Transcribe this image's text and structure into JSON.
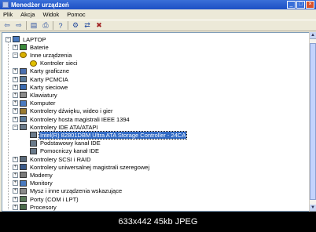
{
  "window": {
    "title": "Menedżer urządzeń"
  },
  "title_controls": {
    "minimize": "_",
    "maximize": "□",
    "close": "×"
  },
  "menu": [
    {
      "label": "Plik"
    },
    {
      "label": "Akcja"
    },
    {
      "label": "Widok"
    },
    {
      "label": "Pomoc"
    }
  ],
  "toolbar": [
    {
      "icon": "back-icon",
      "glyph": "⇦"
    },
    {
      "icon": "forward-icon",
      "glyph": "⇨"
    },
    {
      "icon": "properties-icon",
      "glyph": "▤"
    },
    {
      "icon": "print-icon",
      "glyph": "⎙"
    },
    {
      "icon": "help-icon",
      "glyph": "?"
    },
    {
      "icon": "scan-hardware-icon",
      "glyph": "⚙"
    },
    {
      "icon": "update-driver-icon",
      "glyph": "⇄"
    },
    {
      "icon": "uninstall-icon",
      "glyph": "✖"
    }
  ],
  "tree": {
    "root": {
      "label": "LAPTOP",
      "expander": "−"
    },
    "items": [
      {
        "label": "Baterie",
        "expander": "+",
        "level": 1,
        "icon": "battery-icon",
        "color": "#3a8a3a"
      },
      {
        "label": "Inne urządzenia",
        "expander": "−",
        "level": 1,
        "icon": "unknown-device-icon",
        "color": "#d8b000"
      },
      {
        "label": "Kontroler sieci",
        "expander": "",
        "level": 2,
        "icon": "warning-device-icon",
        "color": "#e0c000"
      },
      {
        "label": "Karty graficzne",
        "expander": "+",
        "level": 1,
        "icon": "display-adapter-icon",
        "color": "#4a6fb0"
      },
      {
        "label": "Karty PCMCIA",
        "expander": "+",
        "level": 1,
        "icon": "pcmcia-icon",
        "color": "#5a7a9a"
      },
      {
        "label": "Karty sieciowe",
        "expander": "+",
        "level": 1,
        "icon": "network-adapter-icon",
        "color": "#3a6ab0"
      },
      {
        "label": "Klawiatury",
        "expander": "+",
        "level": 1,
        "icon": "keyboard-icon",
        "color": "#8a8a8a"
      },
      {
        "label": "Komputer",
        "expander": "+",
        "level": 1,
        "icon": "computer-icon",
        "color": "#4a7ac0"
      },
      {
        "label": "Kontrolery dźwięku, wideo i gier",
        "expander": "+",
        "level": 1,
        "icon": "sound-icon",
        "color": "#9a7a30"
      },
      {
        "label": "Kontrolery hosta magistrali IEEE 1394",
        "expander": "+",
        "level": 1,
        "icon": "ieee1394-icon",
        "color": "#5a7a9a"
      },
      {
        "label": "Kontrolery IDE ATA/ATAPI",
        "expander": "−",
        "level": 1,
        "icon": "ide-controller-icon",
        "color": "#6a7a8a"
      },
      {
        "label": "Intel(R) 82801DBM Ultra ATA Storage Controller - 24CA",
        "expander": "",
        "level": 2,
        "icon": "ide-device-icon",
        "color": "#6a7a8a",
        "selected": true
      },
      {
        "label": "Podstawowy kanał IDE",
        "expander": "",
        "level": 2,
        "icon": "ide-channel-icon",
        "color": "#6a7a8a"
      },
      {
        "label": "Pomocniczy kanał IDE",
        "expander": "",
        "level": 2,
        "icon": "ide-channel-icon",
        "color": "#6a7a8a"
      },
      {
        "label": "Kontrolery SCSI i RAID",
        "expander": "+",
        "level": 1,
        "icon": "scsi-icon",
        "color": "#5a6a7a"
      },
      {
        "label": "Kontrolery uniwersalnej magistrali szeregowej",
        "expander": "+",
        "level": 1,
        "icon": "usb-icon",
        "color": "#3a5a8a"
      },
      {
        "label": "Modemy",
        "expander": "+",
        "level": 1,
        "icon": "modem-icon",
        "color": "#7a7a7a"
      },
      {
        "label": "Monitory",
        "expander": "+",
        "level": 1,
        "icon": "monitor-icon",
        "color": "#4a7ac0"
      },
      {
        "label": "Mysz i inne urządzenia wskazujące",
        "expander": "+",
        "level": 1,
        "icon": "mouse-icon",
        "color": "#8a8a8a"
      },
      {
        "label": "Porty (COM i LPT)",
        "expander": "+",
        "level": 1,
        "icon": "port-icon",
        "color": "#5a7a5a"
      },
      {
        "label": "Procesory",
        "expander": "+",
        "level": 1,
        "icon": "processor-icon",
        "color": "#4a6a4a"
      }
    ]
  },
  "caption": "633x442  45kb  JPEG"
}
